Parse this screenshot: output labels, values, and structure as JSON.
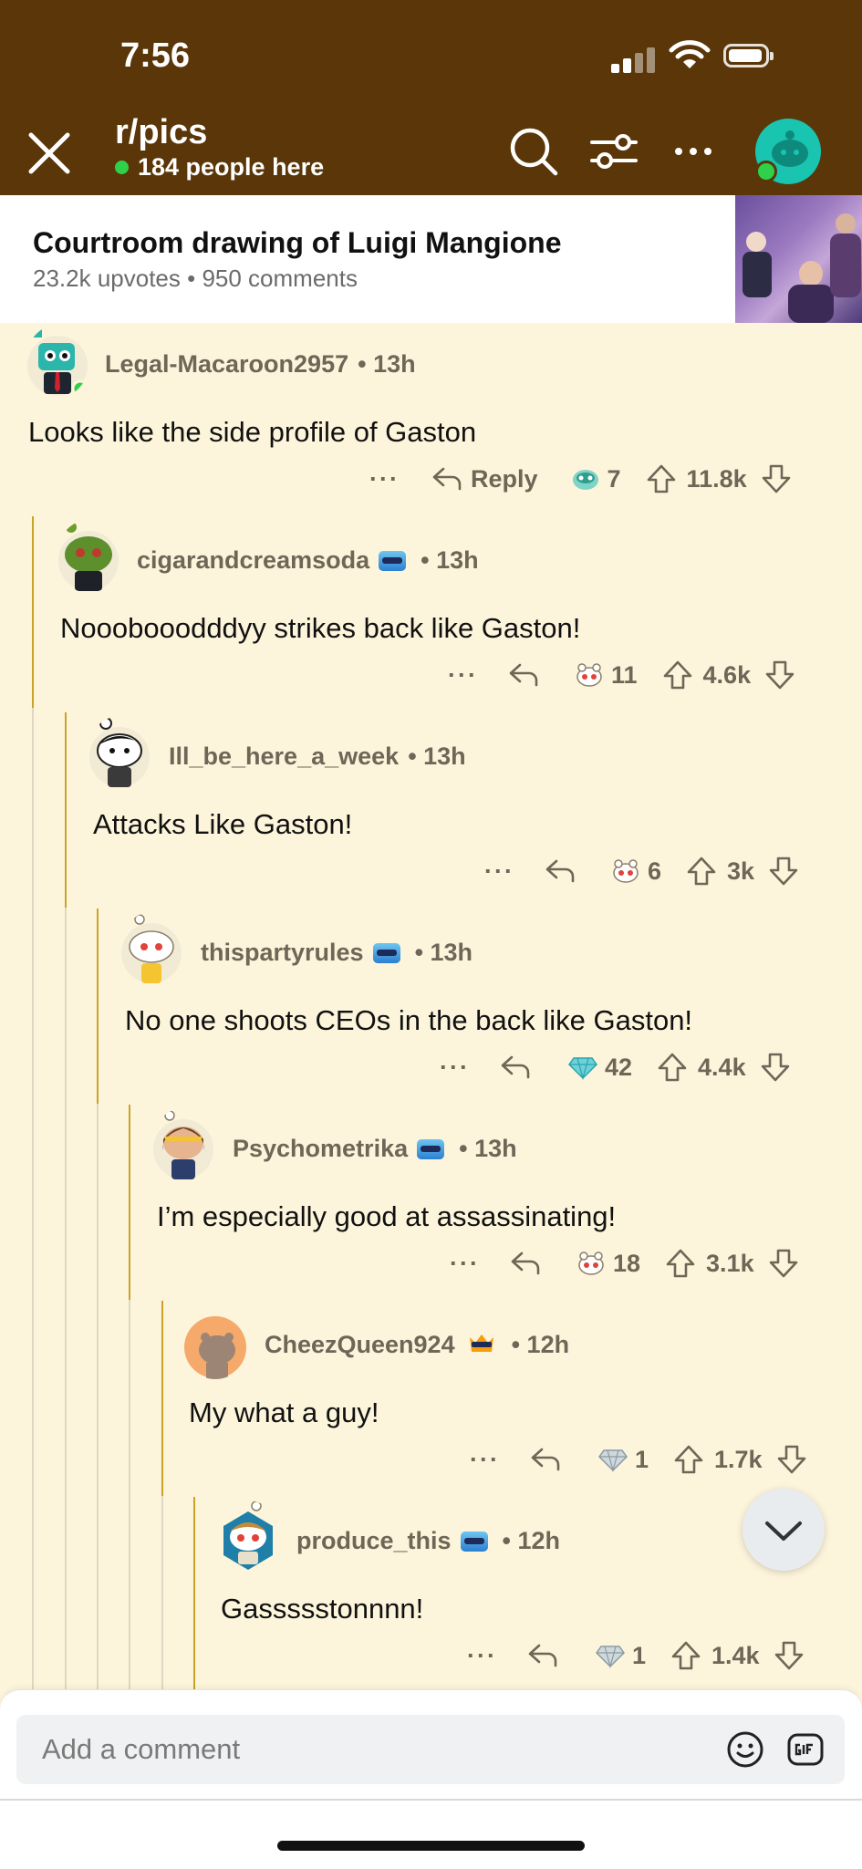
{
  "status_bar": {
    "time": "7:56"
  },
  "header": {
    "subreddit": "r/pics",
    "online_count": "184 people here",
    "accent_bg": "#5a3608"
  },
  "post": {
    "title": "Courtroom drawing of Luigi Mangione",
    "stats": "23.2k upvotes • 950 comments"
  },
  "comments": [
    {
      "author": "Legal-Macaroon2957",
      "age": "• 13h",
      "text": "Looks like the side profile of Gaston",
      "reply_label": "Reply",
      "award_count": "7",
      "score": "11.8k",
      "award_icon": "face-award-icon"
    },
    {
      "author": "cigarandcreamsoda",
      "age": "• 13h",
      "text": "Nooobooodddyy strikes back like Gaston!",
      "award_count": "11",
      "score": "4.6k",
      "award_icon": "snoo-award-icon"
    },
    {
      "author": "Ill_be_here_a_week",
      "age": "• 13h",
      "text": "Attacks Like Gaston!",
      "award_count": "6",
      "score": "3k",
      "award_icon": "snoo-award-icon"
    },
    {
      "author": "thispartyrules",
      "age": "• 13h",
      "text": "No one shoots CEOs in the back like Gaston!",
      "award_count": "42",
      "score": "4.4k",
      "award_icon": "diamond-award-icon"
    },
    {
      "author": "Psychometrika",
      "age": "• 13h",
      "text": "I’m especially good at assassinating!",
      "award_count": "18",
      "score": "3.1k",
      "award_icon": "snoo-award-icon"
    },
    {
      "author": "CheezQueen924",
      "age": "• 12h",
      "text": "My what a guy!",
      "award_count": "1",
      "score": "1.7k",
      "award_icon": "diamond-award-icon"
    },
    {
      "author": "produce_this",
      "age": "• 12h",
      "text": "Gassssstonnnn!",
      "award_count": "1",
      "score": "1.4k",
      "award_icon": "diamond-award-icon"
    }
  ],
  "composer": {
    "placeholder": "Add a comment"
  }
}
